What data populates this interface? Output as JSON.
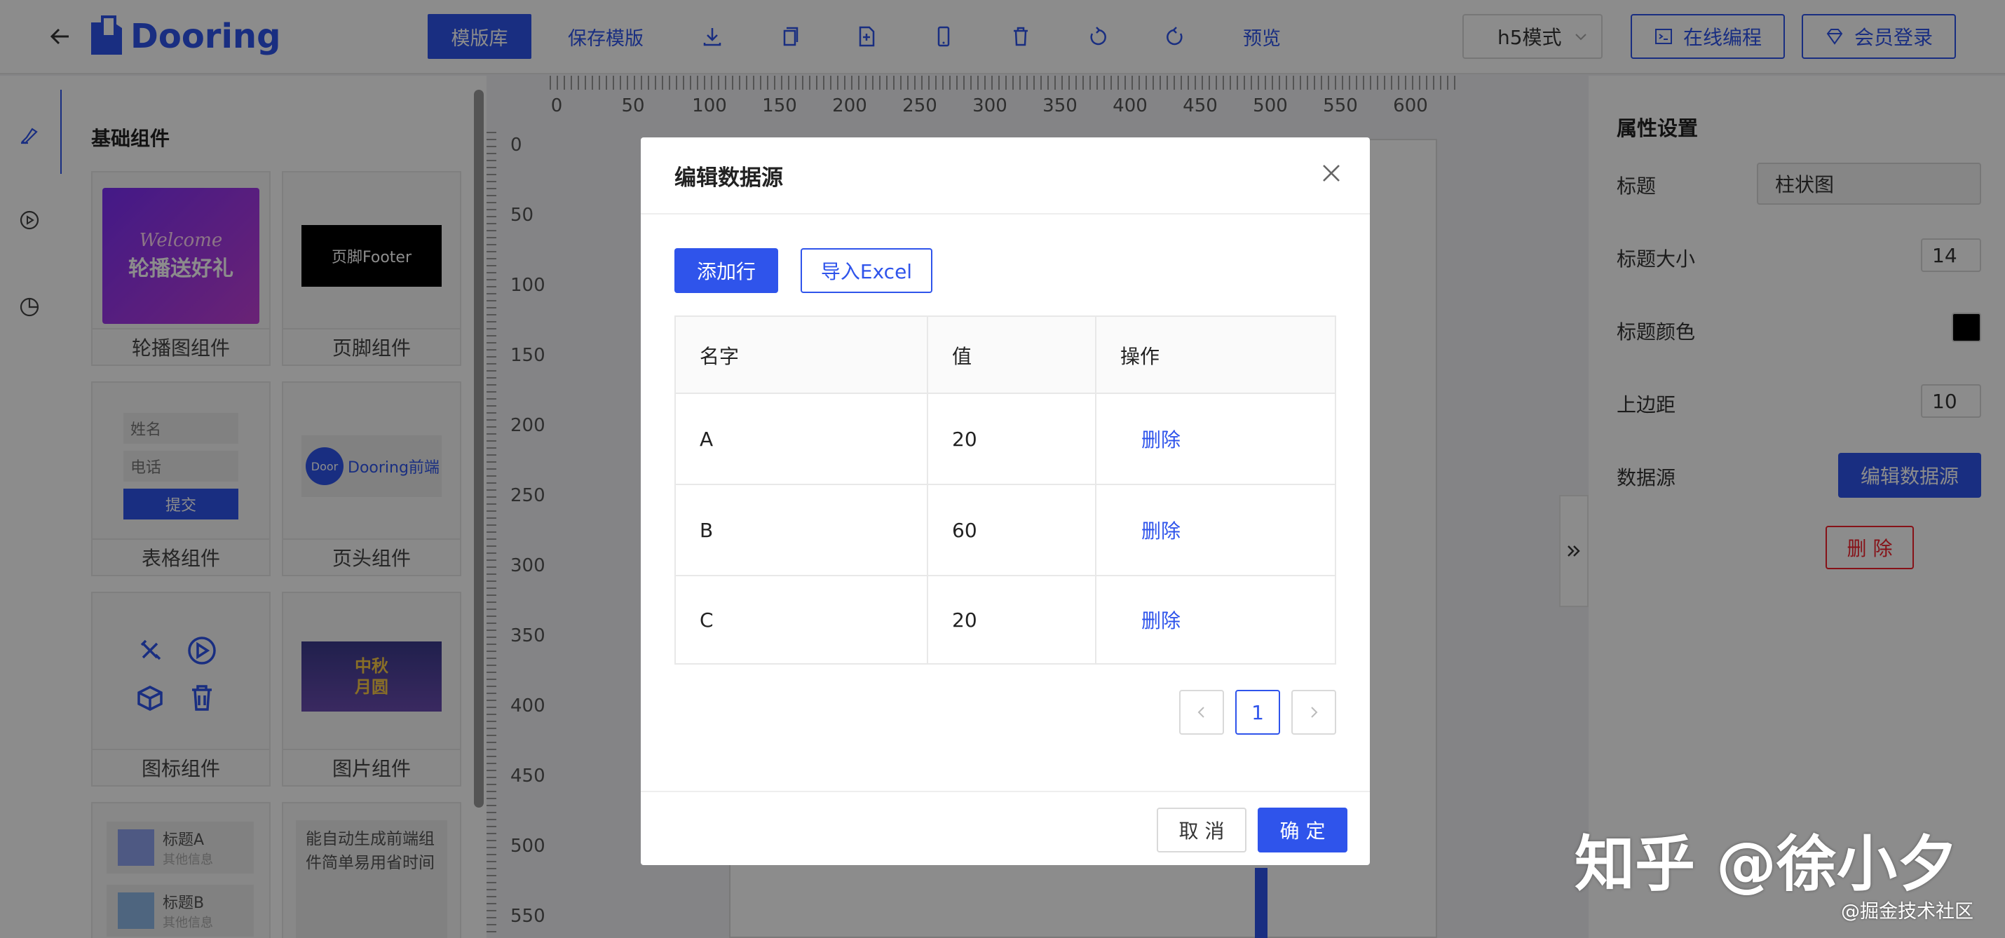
{
  "header": {
    "logo_text": "Dooring",
    "toolbar": {
      "template_lib": "模版库",
      "save_template": "保存模版",
      "preview": "预览"
    },
    "mode_select": "h5模式",
    "online_code": "在线编程",
    "member_login": "会员登录"
  },
  "left_panel": {
    "title": "基础组件",
    "cards": [
      {
        "label": "轮播图组件",
        "thumb_text": "Welcome",
        "thumb_text2": "轮播送好礼"
      },
      {
        "label": "页脚组件",
        "thumb_text": "页脚Footer"
      },
      {
        "label": "表格组件",
        "field1": "姓名",
        "field2": "电话",
        "submit": "提交"
      },
      {
        "label": "页头组件",
        "badge": "Door",
        "brand": "Dooring前端"
      },
      {
        "label": "图标组件"
      },
      {
        "label": "图片组件",
        "thumb_text": "中秋",
        "thumb_text2": "月圆"
      },
      {
        "item_a_title": "标题A",
        "item_a_sub": "其他信息",
        "item_b_title": "标题B",
        "item_b_sub": "其他信息"
      },
      {
        "text": "能自动生成前端组件简单易用省时间"
      }
    ]
  },
  "rulers": {
    "horizontal": [
      "0",
      "50",
      "100",
      "150",
      "200",
      "250",
      "300",
      "350",
      "400",
      "450",
      "500",
      "550",
      "600"
    ],
    "vertical": [
      "0",
      "50",
      "100",
      "150",
      "200",
      "250",
      "300",
      "350",
      "400",
      "450",
      "500",
      "550"
    ]
  },
  "props": {
    "title": "属性设置",
    "title_label": "标题",
    "title_value": "柱状图",
    "title_size_label": "标题大小",
    "title_size_value": "14",
    "title_color_label": "标题颜色",
    "title_color_value": "#000000",
    "margin_top_label": "上边距",
    "margin_top_value": "10",
    "datasource_label": "数据源",
    "edit_datasource": "编辑数据源",
    "delete": "删 除"
  },
  "modal": {
    "title": "编辑数据源",
    "add_row": "添加行",
    "import_excel": "导入Excel",
    "columns": [
      "名字",
      "值",
      "操作"
    ],
    "rows": [
      {
        "name": "A",
        "value": "20",
        "action": "删除"
      },
      {
        "name": "B",
        "value": "60",
        "action": "删除"
      },
      {
        "name": "C",
        "value": "20",
        "action": "删除"
      }
    ],
    "page": "1",
    "cancel": "取 消",
    "ok": "确 定"
  },
  "watermark": {
    "main": "知乎 @徐小夕",
    "sub": "@掘金技术社区"
  },
  "colors": {
    "primary": "#2f54eb",
    "danger": "#f5222d"
  }
}
